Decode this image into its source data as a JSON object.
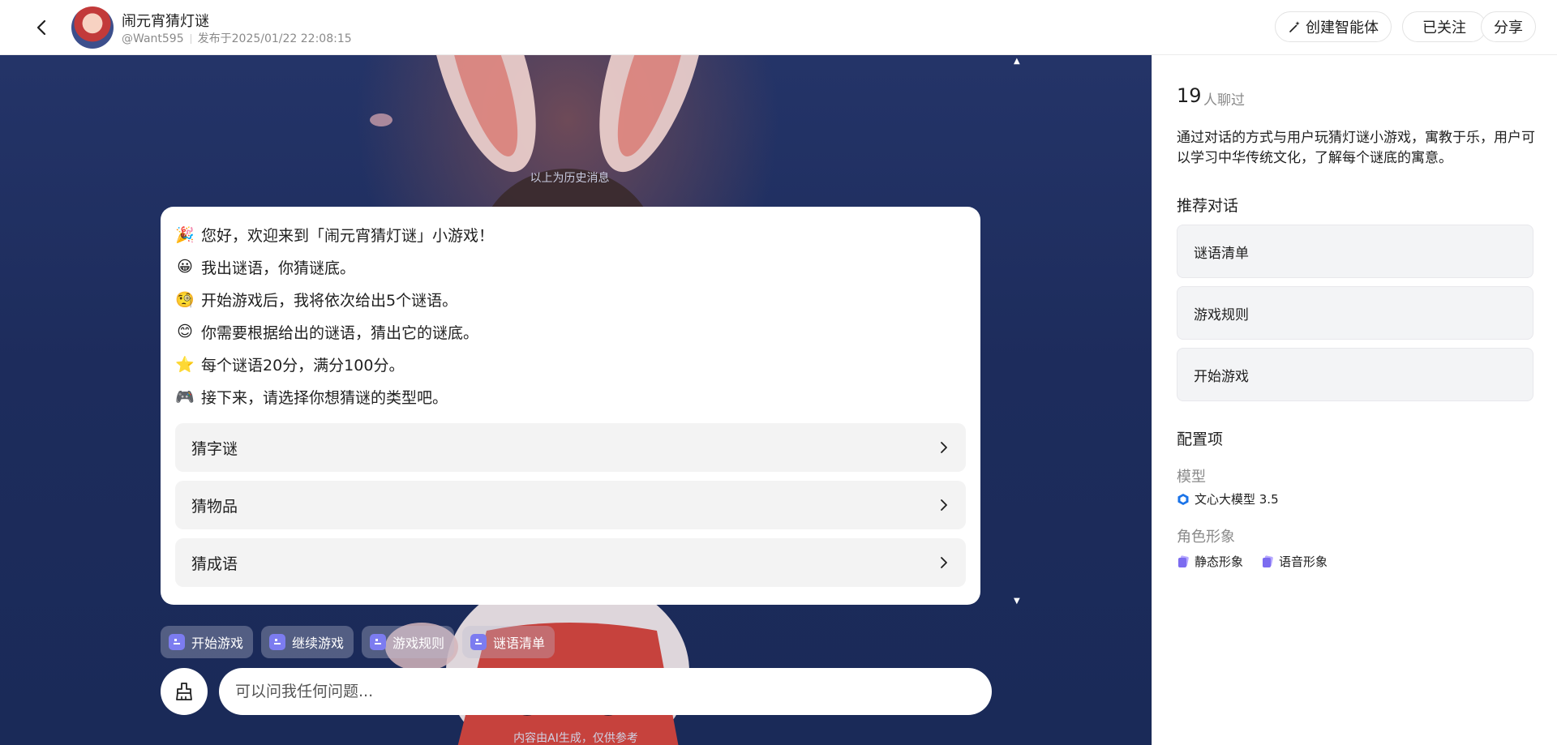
{
  "header": {
    "title": "闹元宵猜灯谜",
    "author": "@Want595",
    "published": "发布于2025/01/22 22:08:15",
    "create_label": "创建智能体",
    "follow_label": "已关注",
    "share_label": "分享"
  },
  "chat": {
    "history_note": "以上为历史消息",
    "lines": [
      {
        "emoji": "🎉",
        "text": "您好，欢迎来到「闹元宵猜灯谜」小游戏！"
      },
      {
        "emoji": "😀",
        "text": "我出谜语，你猜谜底。"
      },
      {
        "emoji": "🧐",
        "text": "开始游戏后，我将依次给出5个谜语。"
      },
      {
        "emoji": "😊",
        "text": "你需要根据给出的谜语，猜出它的谜底。"
      },
      {
        "emoji": "⭐",
        "text": "每个谜语20分，满分100分。"
      },
      {
        "emoji": "🎮",
        "text": "接下来，请选择你想猜谜的类型吧。"
      }
    ],
    "options": [
      "猜字谜",
      "猜物品",
      "猜成语"
    ],
    "chips": [
      "开始游戏",
      "继续游戏",
      "游戏规则",
      "谜语清单"
    ],
    "input_placeholder": "可以问我任何问题...",
    "disclaimer": "内容由AI生成，仅供参考"
  },
  "panel": {
    "count": "19",
    "count_label": "人聊过",
    "description": "通过对话的方式与用户玩猜灯谜小游戏，寓教于乐，用户可以学习中华传统文化，了解每个谜底的寓意。",
    "recommend_title": "推荐对话",
    "recommendations": [
      "谜语清单",
      "游戏规则",
      "开始游戏"
    ],
    "config_title": "配置项",
    "model_label": "模型",
    "model_value": "文心大模型 3.5",
    "role_label": "角色形象",
    "role_static": "静态形象",
    "role_voice": "语音形象"
  },
  "colors": {
    "chat_bg": "#1d2c5c",
    "chip_icon": "#7c7cf0",
    "model_icon": "#1a73e8"
  }
}
